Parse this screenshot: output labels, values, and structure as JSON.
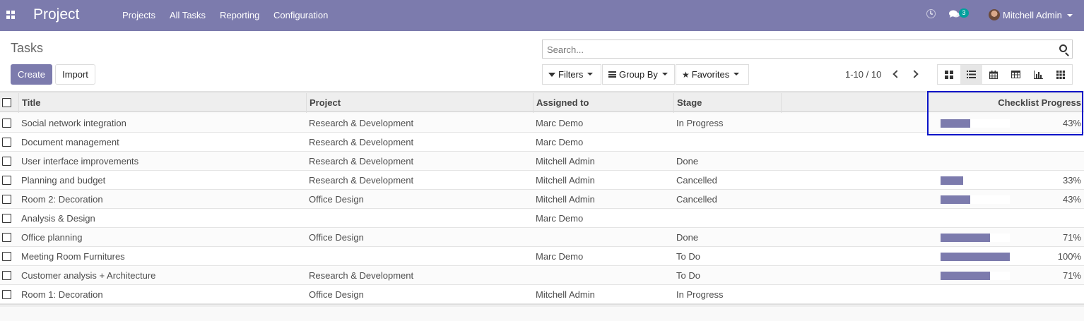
{
  "navbar": {
    "brand": "Project",
    "menu": [
      "Projects",
      "All Tasks",
      "Reporting",
      "Configuration"
    ],
    "chat_count": "3",
    "user": "Mitchell Admin",
    "icons": [
      "apps-icon",
      "clock-icon",
      "chat-icon"
    ]
  },
  "control_panel": {
    "breadcrumb": "Tasks",
    "create_label": "Create",
    "import_label": "Import",
    "search_placeholder": "Search...",
    "filters_label": "Filters",
    "groupby_label": "Group By",
    "favorites_label": "Favorites",
    "pager": "1-10 / 10",
    "views": [
      "kanban",
      "list",
      "calendar",
      "pivot",
      "graph",
      "grid"
    ],
    "active_view": "list"
  },
  "table": {
    "headers": {
      "title": "Title",
      "project": "Project",
      "assigned": "Assigned to",
      "stage": "Stage",
      "progress": "Checklist Progress"
    },
    "accent_color": "#7c7bad",
    "highlight_color": "#0a14c8",
    "rows": [
      {
        "title": "Social network integration",
        "project": "Research & Development",
        "assigned": "Marc Demo",
        "stage": "In Progress",
        "progress": "43%",
        "progress_value": 43
      },
      {
        "title": "Document management",
        "project": "Research & Development",
        "assigned": "Marc Demo",
        "stage": "",
        "progress": "",
        "progress_value": null
      },
      {
        "title": "User interface improvements",
        "project": "Research & Development",
        "assigned": "Mitchell Admin",
        "stage": "Done",
        "progress": "",
        "progress_value": null
      },
      {
        "title": "Planning and budget",
        "project": "Research & Development",
        "assigned": "Mitchell Admin",
        "stage": "Cancelled",
        "progress": "33%",
        "progress_value": 33
      },
      {
        "title": "Room 2: Decoration",
        "project": "Office Design",
        "assigned": "Mitchell Admin",
        "stage": "Cancelled",
        "progress": "43%",
        "progress_value": 43
      },
      {
        "title": "Analysis & Design",
        "project": "",
        "assigned": "Marc Demo",
        "stage": "",
        "progress": "",
        "progress_value": null
      },
      {
        "title": "Office planning",
        "project": "Office Design",
        "assigned": "",
        "stage": "Done",
        "progress": "71%",
        "progress_value": 71
      },
      {
        "title": "Meeting Room Furnitures",
        "project": "",
        "assigned": "Marc Demo",
        "stage": "To Do",
        "progress": "100%",
        "progress_value": 100
      },
      {
        "title": "Customer analysis + Architecture",
        "project": "Research & Development",
        "assigned": "",
        "stage": "To Do",
        "progress": "71%",
        "progress_value": 71
      },
      {
        "title": "Room 1: Decoration",
        "project": "Office Design",
        "assigned": "Mitchell Admin",
        "stage": "In Progress",
        "progress": "",
        "progress_value": null
      }
    ]
  }
}
